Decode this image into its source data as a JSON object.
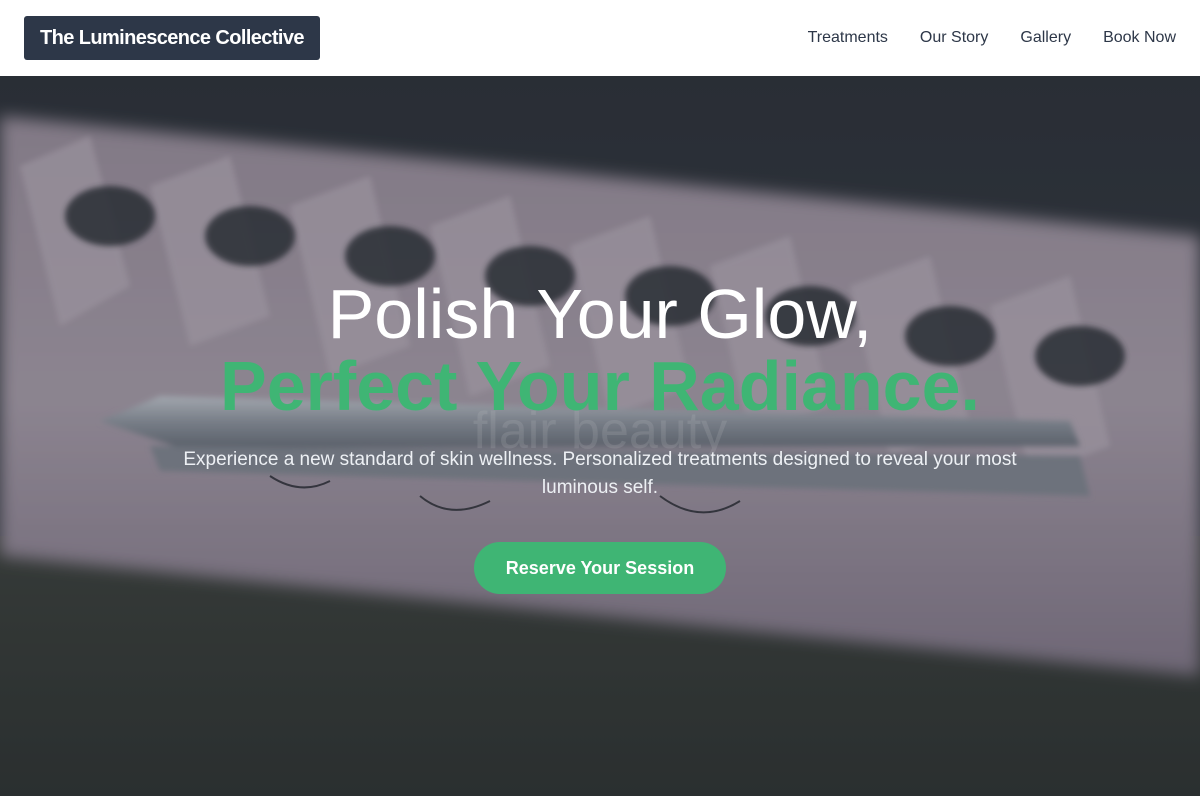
{
  "header": {
    "logo_text": "The Luminescence Collective",
    "nav": [
      {
        "label": "Treatments"
      },
      {
        "label": "Our Story"
      },
      {
        "label": "Gallery"
      },
      {
        "label": "Book Now"
      }
    ]
  },
  "hero": {
    "headline_line1": "Polish Your Glow,",
    "headline_line2": "Perfect Your Radiance.",
    "subtitle": "Experience a new standard of skin wellness. Personalized treatments designed to reveal your most luminous self.",
    "cta_label": "Reserve Your Session",
    "background_watermark": "flair beauty"
  },
  "colors": {
    "accent_green": "#3fb574",
    "logo_bg": "#2d3748",
    "nav_text": "#2d3748"
  }
}
